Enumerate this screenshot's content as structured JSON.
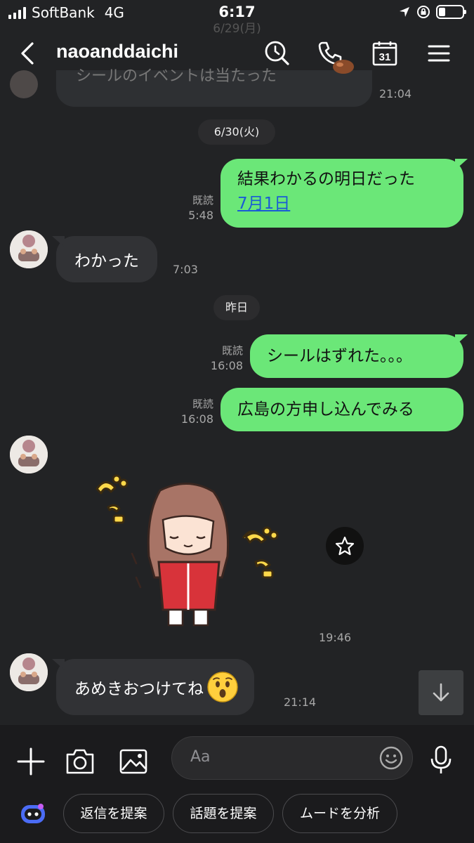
{
  "status": {
    "carrier": "SoftBank",
    "network": "4G",
    "time": "6:17"
  },
  "header": {
    "title": "naoanddaichi",
    "ghost_date": "6/29(月)"
  },
  "ghost_message": {
    "text": "シールのイベントは当たった",
    "time": "21:04"
  },
  "dates": {
    "d1": "6/30(火)",
    "d2": "昨日"
  },
  "messages": {
    "m1": {
      "line1": "結果わかるの明日だった",
      "link": "7月1日",
      "read": "既読",
      "time": "5:48"
    },
    "m2": {
      "text": "わかった",
      "time": "7:03"
    },
    "m3": {
      "text": "シールはずれた。。。",
      "read": "既読",
      "time": "16:08"
    },
    "m4": {
      "text": "広島の方申し込んでみる",
      "read": "既読",
      "time": "16:08"
    },
    "m5": {
      "time": "19:46"
    },
    "m6": {
      "text": "あめきおつけてね",
      "time": "21:14"
    }
  },
  "input": {
    "placeholder": "Aa"
  },
  "chips": {
    "c1": "返信を提案",
    "c2": "話題を提案",
    "c3": "ムードを分析"
  },
  "calendar_day": "31",
  "colors": {
    "accent_green": "#6be778",
    "link_blue": "#1a5bd6",
    "background": "#222325"
  }
}
